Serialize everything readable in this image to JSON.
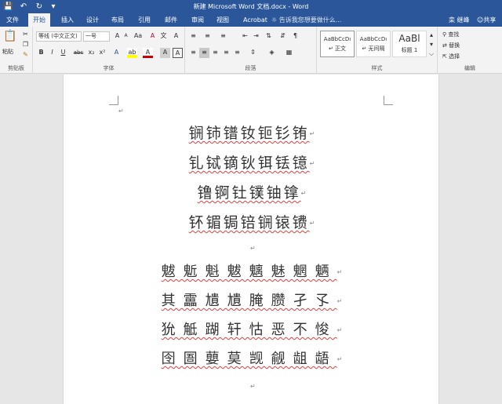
{
  "window": {
    "title": "新建 Microsoft Word 文档.docx - Word"
  },
  "quick_access": {
    "save_icon": "save-icon",
    "undo_icon": "undo-icon",
    "redo_icon": "redo-icon",
    "customize_icon": "customize-icon"
  },
  "tabs": [
    {
      "label": "文件"
    },
    {
      "label": "开始"
    },
    {
      "label": "插入"
    },
    {
      "label": "设计"
    },
    {
      "label": "布局"
    },
    {
      "label": "引用"
    },
    {
      "label": "邮件"
    },
    {
      "label": "审阅"
    },
    {
      "label": "视图"
    },
    {
      "label": "Acrobat"
    }
  ],
  "tell_me": "告诉我您想要做什么...",
  "user": "栾 继峰",
  "share": "共享",
  "ribbon": {
    "clipboard": {
      "paste": "粘贴",
      "label": "剪贴板"
    },
    "font": {
      "family": "等线 (中文正文)",
      "size": "一号",
      "label": "字体",
      "grow": "A",
      "shrink": "A",
      "case": "Aa",
      "clear": "A",
      "bold": "B",
      "italic": "I",
      "underline": "U",
      "strike": "abc",
      "sub": "x₂",
      "sup": "x²",
      "wen": "文",
      "phonetic": "A",
      "effects": "A",
      "highlight": "ab",
      "color": "A",
      "shade": "A",
      "border": "A"
    },
    "paragraph": {
      "label": "段落"
    },
    "styles": {
      "label": "样式",
      "items": [
        {
          "sample": "AaBbCcDı",
          "name": "↵ 正文"
        },
        {
          "sample": "AaBbCcDı",
          "name": "↵ 无间隔"
        },
        {
          "sample": "AaBl",
          "name": "标题 1"
        }
      ]
    },
    "editing": {
      "find": "查找",
      "replace": "替换",
      "select": "选择",
      "label": "编辑"
    }
  },
  "document": {
    "para_mark": "↵",
    "block1": [
      "锎铈镨钕钷钐铕",
      "钆铽镝钬铒铥镱",
      "镥锕钍镤铀镎",
      "钚镅锔锫锎锿镄"
    ],
    "block2": [
      "魃鬿魁魃魑魅魍魉",
      "其靁尵尵腌臜孑孓",
      "狁觝䠒轩怙恶不悛",
      "囹圄蘡莫觊觎龃龉"
    ]
  }
}
